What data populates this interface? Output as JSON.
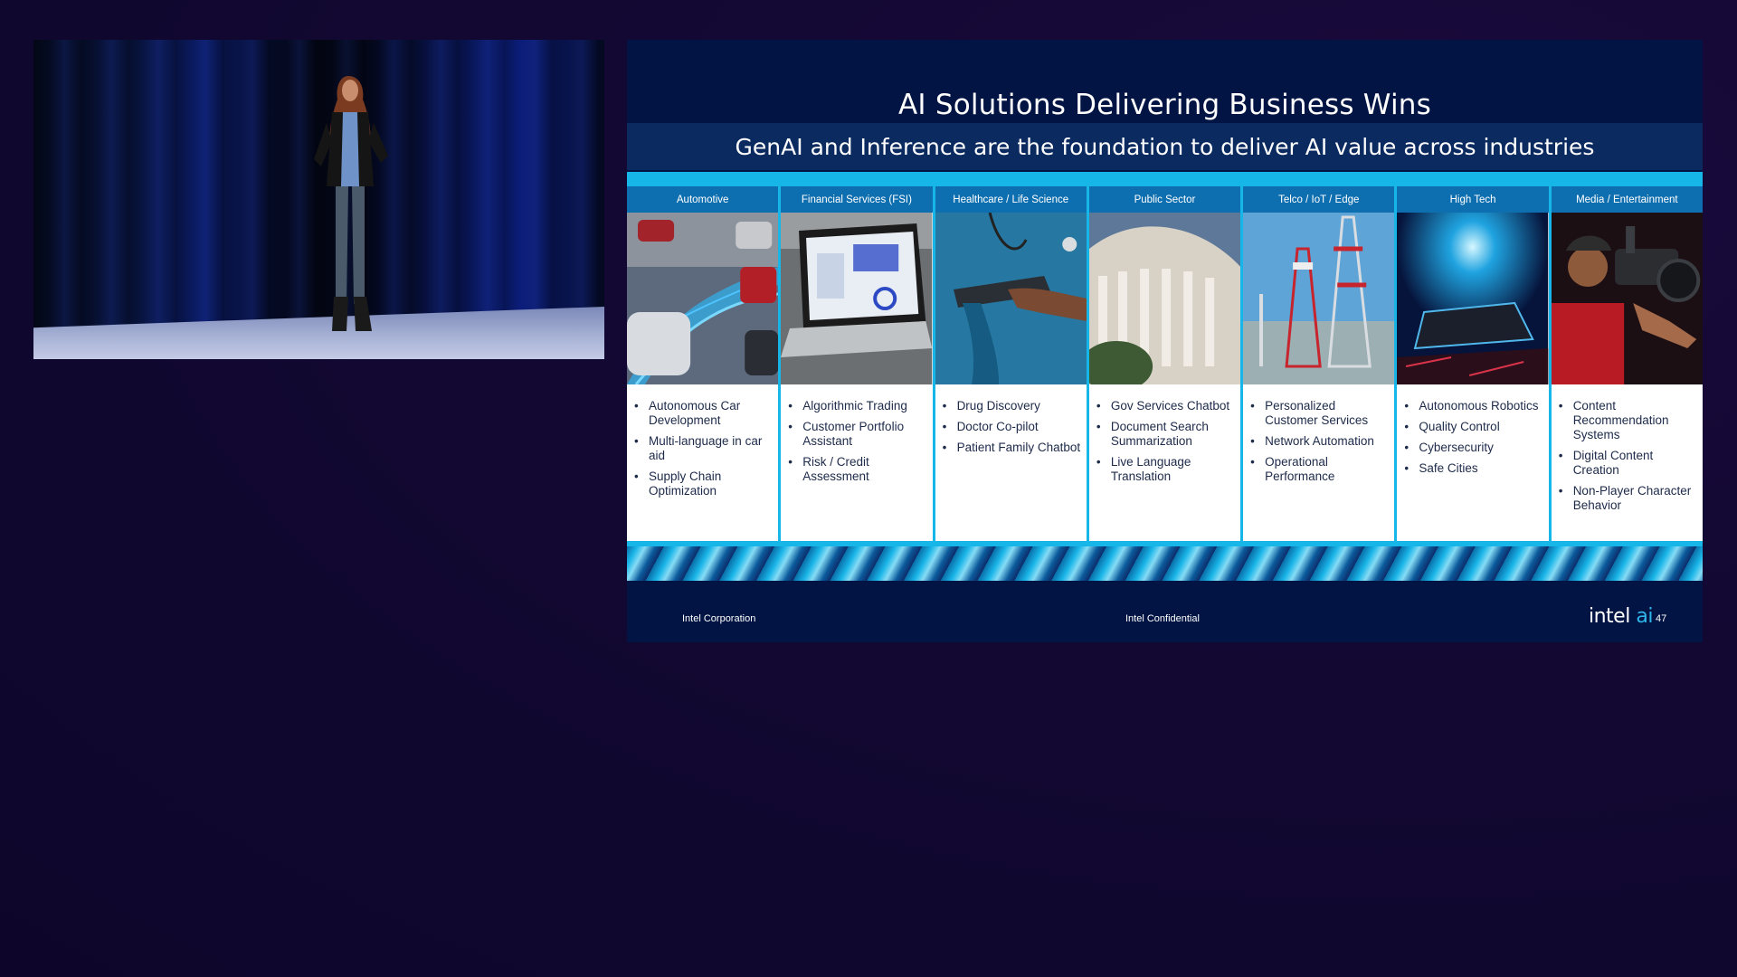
{
  "slide": {
    "title": "AI Solutions Delivering Business Wins",
    "subtitle": "GenAI and Inference are the foundation to deliver AI value across industries",
    "columns": [
      {
        "header": "Automotive",
        "items": [
          "Autonomous Car Development",
          "Multi-language in car aid",
          "Supply Chain Optimization"
        ]
      },
      {
        "header": "Financial Services (FSI)",
        "items": [
          "Algorithmic Trading",
          "Customer Portfolio Assistant",
          "Risk / Credit Assessment"
        ]
      },
      {
        "header": "Healthcare / Life Science",
        "items": [
          "Drug Discovery",
          "Doctor Co-pilot",
          "Patient Family Chatbot"
        ]
      },
      {
        "header": "Public Sector",
        "items": [
          "Gov Services Chatbot",
          "Document Search Summarization",
          "Live Language Translation"
        ]
      },
      {
        "header": "Telco / IoT / Edge",
        "items": [
          "Personalized Customer Services",
          "Network Automation",
          "Operational Performance"
        ]
      },
      {
        "header": "High Tech",
        "items": [
          "Autonomous Robotics",
          "Quality Control",
          "Cybersecurity",
          "Safe Cities"
        ]
      },
      {
        "header": "Media / Entertainment",
        "items": [
          "Content Recommendation Systems",
          "Digital Content Creation",
          "Non-Player Character Behavior"
        ]
      }
    ],
    "footer": {
      "left": "Intel Corporation",
      "center": "Intel Confidential",
      "logo_intel": "intel",
      "logo_ai": "ai",
      "page": "47"
    }
  },
  "colors": {
    "slide_bg": "#021443",
    "header_blue": "#0e6fb0",
    "accent_cyan": "#16b6e8",
    "page_bg": "#130833"
  }
}
